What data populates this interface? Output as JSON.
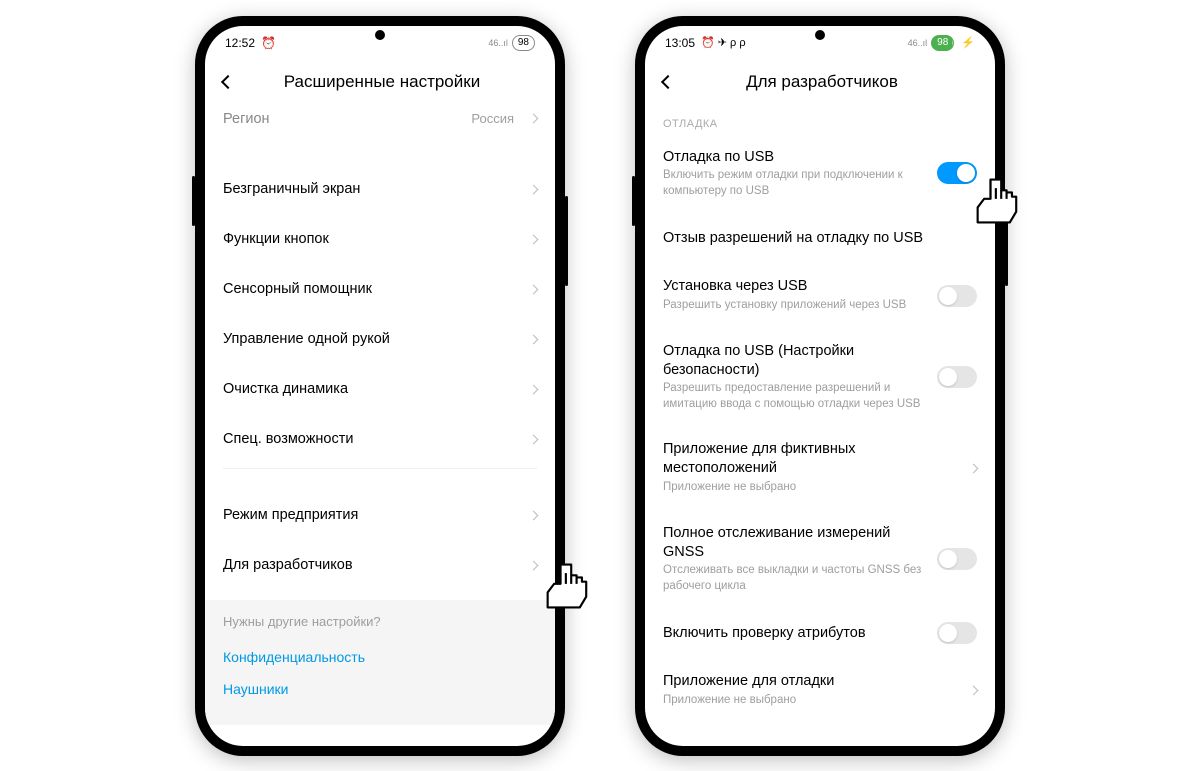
{
  "phone1": {
    "status": {
      "time": "12:52",
      "alarm_icon": "⏰",
      "signal": "46..ıl",
      "battery": "98"
    },
    "header_title": "Расширенные настройки",
    "region_label": "Регион",
    "region_value": "Россия",
    "items": [
      "Безграничный экран",
      "Функции кнопок",
      "Сенсорный помощник",
      "Управление одной рукой",
      "Очистка динамика",
      "Спец. возможности"
    ],
    "items2": [
      "Режим предприятия",
      "Для разработчиков"
    ],
    "footer_label": "Нужны другие настройки?",
    "footer_links": [
      "Конфиденциальность",
      "Наушники"
    ]
  },
  "phone2": {
    "status": {
      "time": "13:05",
      "icons": "⏰ ✈ ρ ρ",
      "signal": "46..ıl",
      "battery": "98"
    },
    "header_title": "Для разработчиков",
    "section": "ОТЛАДКА",
    "rows": [
      {
        "title": "Отладка по USB",
        "sub": "Включить режим отладки при подключении к компьютеру по USB",
        "toggle": true,
        "on": true
      },
      {
        "title": "Отзыв разрешений на отладку по USB"
      },
      {
        "title": "Установка через USB",
        "sub": "Разрешить установку приложений через USB",
        "toggle": true,
        "on": false
      },
      {
        "title": "Отладка по USB (Настройки безопасности)",
        "sub": "Разрешить предоставление разрешений и имитацию ввода с помощью отладки через USB",
        "toggle": true,
        "on": false
      },
      {
        "title": "Приложение для фиктивных местоположений",
        "sub": "Приложение не выбрано",
        "chevron": true
      },
      {
        "title": "Полное отслеживание измерений GNSS",
        "sub": "Отслеживать все выкладки и частоты GNSS без рабочего цикла",
        "toggle": true,
        "on": false
      },
      {
        "title": "Включить проверку атрибутов",
        "toggle": true,
        "on": false
      },
      {
        "title": "Приложение для отладки",
        "sub": "Приложение не выбрано",
        "chevron": true
      }
    ]
  }
}
